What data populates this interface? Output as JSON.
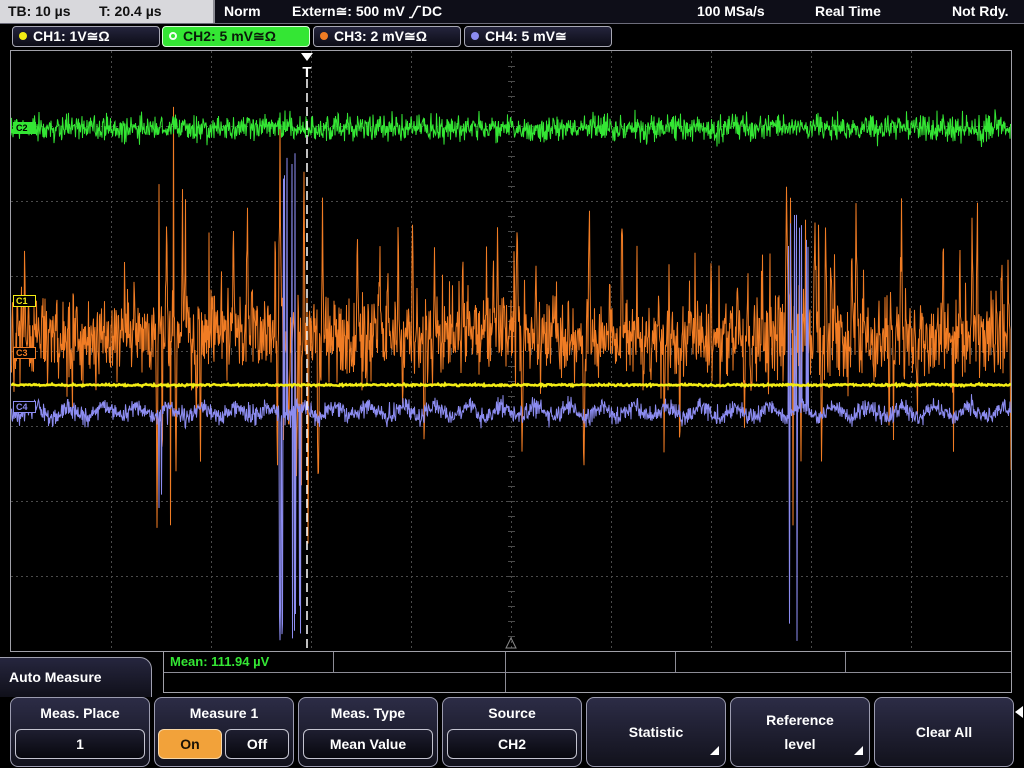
{
  "status_bar": {
    "timebase": "TB: 10 µs",
    "trigger_time": "T: 20.4 µs",
    "trigger_mode": "Norm",
    "trigger_source": "Extern≅: 500 mV",
    "trigger_slope_icon": "rising-edge-icon",
    "trigger_coupling": "DC",
    "sample_rate": "100 MSa/s",
    "acquisition_mode": "Real Time",
    "status": "Not Rdy."
  },
  "channels": [
    {
      "label": "CH1: 1V≅Ω",
      "marker": "C1",
      "color": "#f2ec14",
      "selected": false
    },
    {
      "label": "CH2: 5 mV≅Ω",
      "marker": "C2",
      "color": "#34e634",
      "selected": true
    },
    {
      "label": "CH3: 2 mV≅Ω",
      "marker": "C3",
      "color": "#f07c24",
      "selected": false
    },
    {
      "label": "CH4: 5 mV≅",
      "marker": "C4",
      "color": "#8c8cf0",
      "selected": false
    }
  ],
  "display": {
    "trigger_marker": "T",
    "grid_color": "#4a4a4a"
  },
  "measurement": {
    "readout": "Mean: 111.94 µV",
    "color": "#34e634"
  },
  "menu": {
    "title": "Auto Measure",
    "selected_color": "#f2a23a",
    "menu_icon": "menu-arrow-icon",
    "softkeys": [
      {
        "label": "Meas. Place",
        "value": "1"
      },
      {
        "label": "Measure 1",
        "options": [
          "On",
          "Off"
        ],
        "selected_index": 0
      },
      {
        "label": "Meas. Type",
        "value": "Mean Value"
      },
      {
        "label": "Source",
        "value": "CH2"
      },
      {
        "label": "Statistic",
        "submenu_icon": "submenu-arrow-icon"
      },
      {
        "label_lines": [
          "Reference",
          "level"
        ],
        "submenu_icon": "submenu-arrow-icon"
      },
      {
        "label": "Clear All"
      }
    ]
  }
}
